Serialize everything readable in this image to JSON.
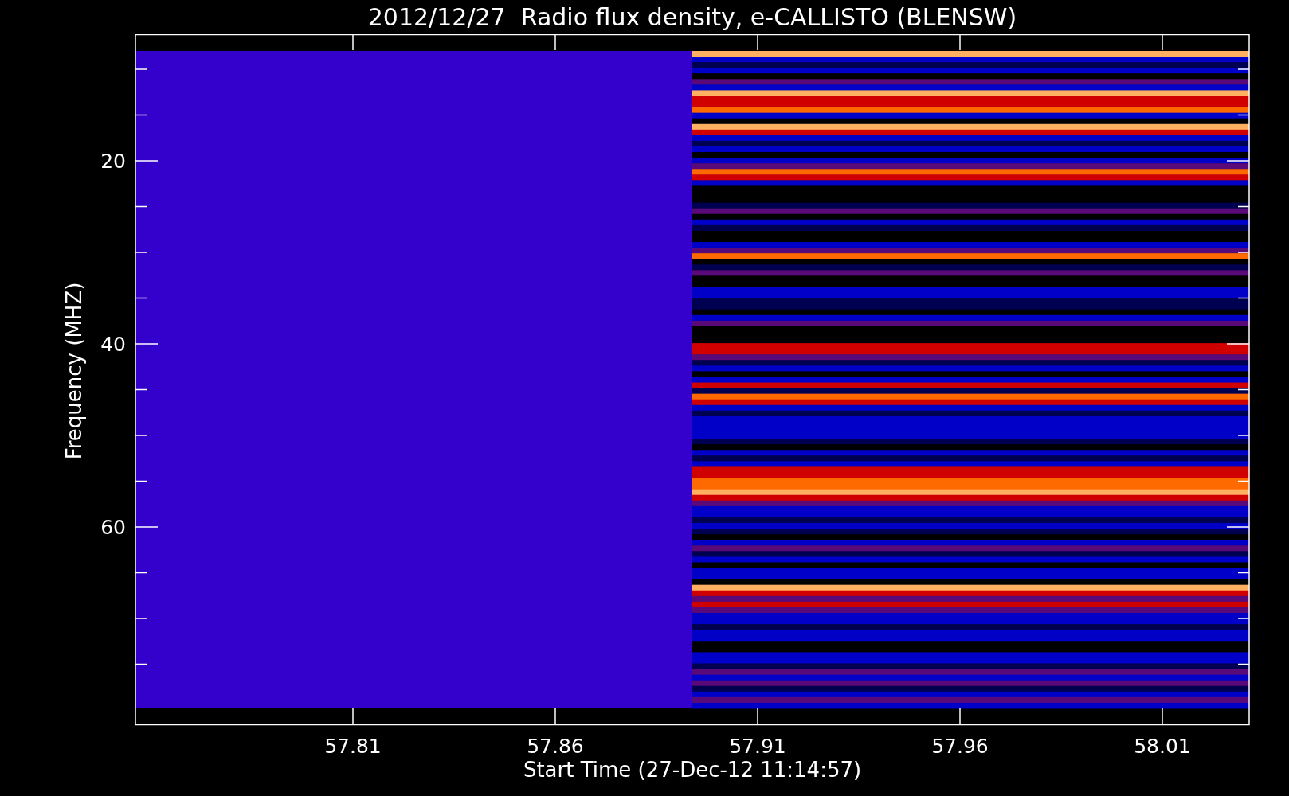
{
  "title": "2012/12/27  Radio flux density, e-CALLISTO (BLENSW)",
  "plot": {
    "ylabel": "Frequency (MHZ)",
    "xlabel": "Start Time (27-Dec-12 11:14:57)",
    "yticks": [
      "20",
      "40",
      "60"
    ],
    "xticks": [
      "57.81",
      "57.86",
      "57.91",
      "57.96",
      "58.01"
    ]
  }
}
